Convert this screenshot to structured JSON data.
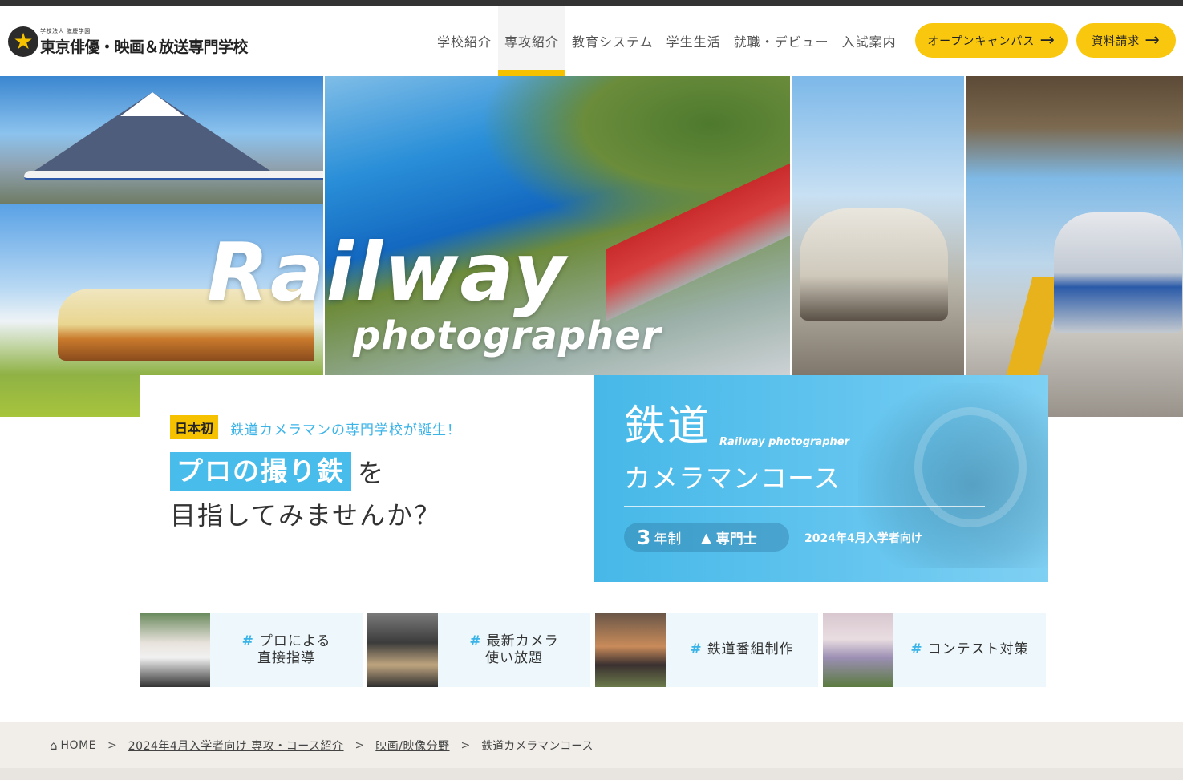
{
  "header": {
    "logo_small": "学校法人 滋慶学園",
    "logo_main": "東京俳優・映画＆放送専門学校",
    "nav": [
      {
        "label": "学校紹介"
      },
      {
        "label": "専攻紹介",
        "active": true
      },
      {
        "label": "教育システム"
      },
      {
        "label": "学生生活"
      },
      {
        "label": "就職・デビュー"
      },
      {
        "label": "入試案内"
      }
    ],
    "btn_open_campus": "オープンキャンパス",
    "btn_request": "資料請求",
    "accent_color": "#f9c80e"
  },
  "hero": {
    "title_main": "Railway",
    "title_sub": "photographer"
  },
  "intro": {
    "tag_first": "日本初",
    "tag_sub": "鉄道カメラマンの専門学校が誕生！",
    "headline_highlight": "プロの撮り鉄",
    "headline_rest": "を",
    "headline_line2": "目指してみませんか？"
  },
  "course": {
    "title": "鉄道",
    "title_en": "Railway photographer",
    "subtitle": "カメラマンコース",
    "years": "3",
    "years_unit": "年制",
    "degree": "専門士",
    "target": "2024年4月入学者向け",
    "bg_color": "#46b8e8"
  },
  "features": [
    {
      "line1": "プロによる",
      "line2": "直接指導"
    },
    {
      "line1": "最新カメラ",
      "line2": "使い放題"
    },
    {
      "line1": "鉄道番組制作",
      "line2": ""
    },
    {
      "line1": "コンテスト対策",
      "line2": ""
    }
  ],
  "breadcrumb": {
    "home": "HOME",
    "level1": "2024年4月入学者向け 専攻・コース紹介",
    "level2": "映画/映像分野",
    "current": "鉄道カメラマンコース",
    "separator": ">"
  }
}
